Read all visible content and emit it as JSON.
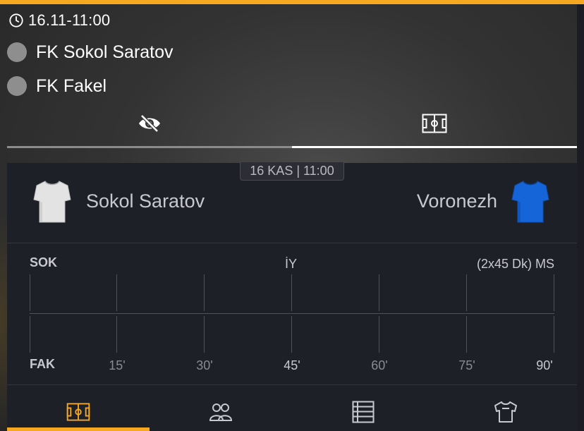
{
  "match_card": {
    "time": "16.11-11:00",
    "teams": [
      {
        "name": "FK Sokol Saratov"
      },
      {
        "name": "FK Fakel"
      }
    ],
    "view_tabs": [
      {
        "icon": "eye-slash-icon",
        "active": false
      },
      {
        "icon": "pitch-icon",
        "active": true
      }
    ]
  },
  "panel": {
    "date_badge": "16 KAS | 11:00",
    "home": {
      "name": "Sokol Saratov",
      "jersey_color": "#e3e3e3"
    },
    "away": {
      "name": "Voronezh",
      "jersey_color": "#1565d8"
    },
    "timeline": {
      "home_code": "SOK",
      "away_code": "FAK",
      "half_label": "İY",
      "full_label": "(2x45 Dk) MS",
      "ticks": [
        "15'",
        "30'",
        "45'",
        "60'",
        "75'",
        "90'"
      ]
    },
    "bottom_tabs": [
      {
        "icon": "pitch-icon",
        "active": true
      },
      {
        "icon": "lineup-icon",
        "active": false
      },
      {
        "icon": "standings-icon",
        "active": false
      },
      {
        "icon": "jersey-icon",
        "active": false
      }
    ]
  },
  "colors": {
    "accent": "#f7a823",
    "panel_bg": "#1e2028",
    "muted_text": "#c8c9cf"
  }
}
